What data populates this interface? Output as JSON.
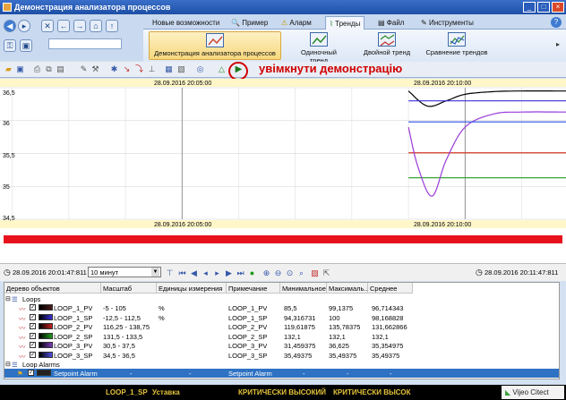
{
  "window": {
    "title": "Демонстрация анализатора процессов"
  },
  "tabs": [
    {
      "label": "Новые возможности"
    },
    {
      "label": "Пример"
    },
    {
      "label": "Аларм"
    },
    {
      "label": "Тренды"
    },
    {
      "label": "Файл"
    },
    {
      "label": "Инструменты"
    }
  ],
  "ribbon": {
    "buttons": [
      {
        "label": "Демонстрация анализатора процессов"
      },
      {
        "label": "Одиночный тренд"
      },
      {
        "label": "Двойной тренд"
      },
      {
        "label": "Сравнение трендов"
      }
    ]
  },
  "annotation": "увімкнути демонстрацію",
  "chart": {
    "top_timestamps": [
      "28.09.2016 20:05:00",
      "28.09.2016 20:10:00"
    ],
    "bottom_timestamps": [
      "28.09.2016 20:05:00",
      "28.09.2016 20:10:00"
    ],
    "y_ticks": [
      "36,5",
      "36",
      "35,5",
      "35",
      "34,5"
    ]
  },
  "chart_data": {
    "type": "line",
    "ylim": [
      34.5,
      36.5
    ],
    "x_range": [
      "28.09.2016 20:01:47:811",
      "28.09.2016 20:11:47:811"
    ],
    "series": [
      {
        "color": "#000000",
        "x": [
          "20:09:00",
          "20:09:20",
          "20:09:40",
          "20:10:00",
          "20:10:30",
          "20:11:00",
          "20:11:47"
        ],
        "values": [
          36.45,
          36.22,
          36.3,
          36.4,
          36.44,
          36.45,
          36.45
        ]
      },
      {
        "color": "#3a30d8",
        "x": [
          "20:09:00",
          "20:11:47"
        ],
        "values": [
          36.3,
          36.3
        ]
      },
      {
        "color": "#d43a2a",
        "x": [
          "20:09:00",
          "20:11:47"
        ],
        "values": [
          35.51,
          35.51
        ]
      },
      {
        "color": "#1e9a1e",
        "x": [
          "20:09:00",
          "20:11:47"
        ],
        "values": [
          35.13,
          35.13
        ]
      },
      {
        "color": "#9a3ad8",
        "x": [
          "20:09:00",
          "20:09:10",
          "20:09:25",
          "20:09:40",
          "20:10:00",
          "20:10:30",
          "20:11:00",
          "20:11:47"
        ],
        "values": [
          35.9,
          35.3,
          34.85,
          35.4,
          35.9,
          36.1,
          36.13,
          36.13
        ]
      },
      {
        "color": "#4060e8",
        "x": [
          "20:09:00",
          "20:11:47"
        ],
        "values": [
          35.98,
          35.98
        ]
      }
    ]
  },
  "controls": {
    "start_time": "28.09.2016 20:01:47:811",
    "duration": "10 минут",
    "end_time": "28.09.2016 20:11:47:811"
  },
  "table": {
    "headers": [
      "Дерево объектов",
      "Масштаб",
      "Единицы измерения",
      "Примечание",
      "Минимальное",
      "Максималь...",
      "Среднее"
    ],
    "groups": [
      {
        "label": "Loops"
      },
      {
        "label": "Loop Alarms"
      }
    ],
    "rows": [
      {
        "name": "LOOP_1_PV",
        "scale": "-5 - 105",
        "units": "%",
        "note": "LOOP_1_PV",
        "min": "85,5",
        "max": "99,1375",
        "avg": "96,714343",
        "color": "#4a1a1a"
      },
      {
        "name": "LOOP_1_SP",
        "scale": "-12,5 - 112,5",
        "units": "%",
        "note": "LOOP_1_SP",
        "min": "94,316731",
        "max": "100",
        "avg": "98,168828",
        "color": "#3a30d8"
      },
      {
        "name": "LOOP_2_PV",
        "scale": "116,25 - 138,75",
        "units": "",
        "note": "LOOP_2_PV",
        "min": "119,61875",
        "max": "135,78375",
        "avg": "131,662866",
        "color": "#c02020"
      },
      {
        "name": "LOOP_2_SP",
        "scale": "131,5 - 133,5",
        "units": "",
        "note": "LOOP_2_SP",
        "min": "132,1",
        "max": "132,1",
        "avg": "132,1",
        "color": "#1e9a1e"
      },
      {
        "name": "LOOP_3_PV",
        "scale": "30,5 - 37,5",
        "units": "",
        "note": "LOOP_3_PV",
        "min": "31,459375",
        "max": "36,625",
        "avg": "35,354975",
        "color": "#7a3ab8"
      },
      {
        "name": "LOOP_3_SP",
        "scale": "34,5 - 36,5",
        "units": "",
        "note": "LOOP_3_SP",
        "min": "35,49375",
        "max": "35,49375",
        "avg": "35,49375",
        "color": "#5050e0"
      }
    ],
    "alarm_row": {
      "name": "Setpoint Alarm",
      "scale": "-",
      "units": "-",
      "note": "Setpoint Alarm",
      "min": "-",
      "max": "-",
      "avg": "-",
      "color": "#222222"
    }
  },
  "statusbar": {
    "tag": "LOOP_1_SP",
    "label": "Уставка",
    "alarm1": "КРИТИЧЕСКИ ВЫСОКИЙ",
    "alarm2": "КРИТИЧЕСКИ ВЫСОК",
    "brand": "Vijeo Citect"
  }
}
